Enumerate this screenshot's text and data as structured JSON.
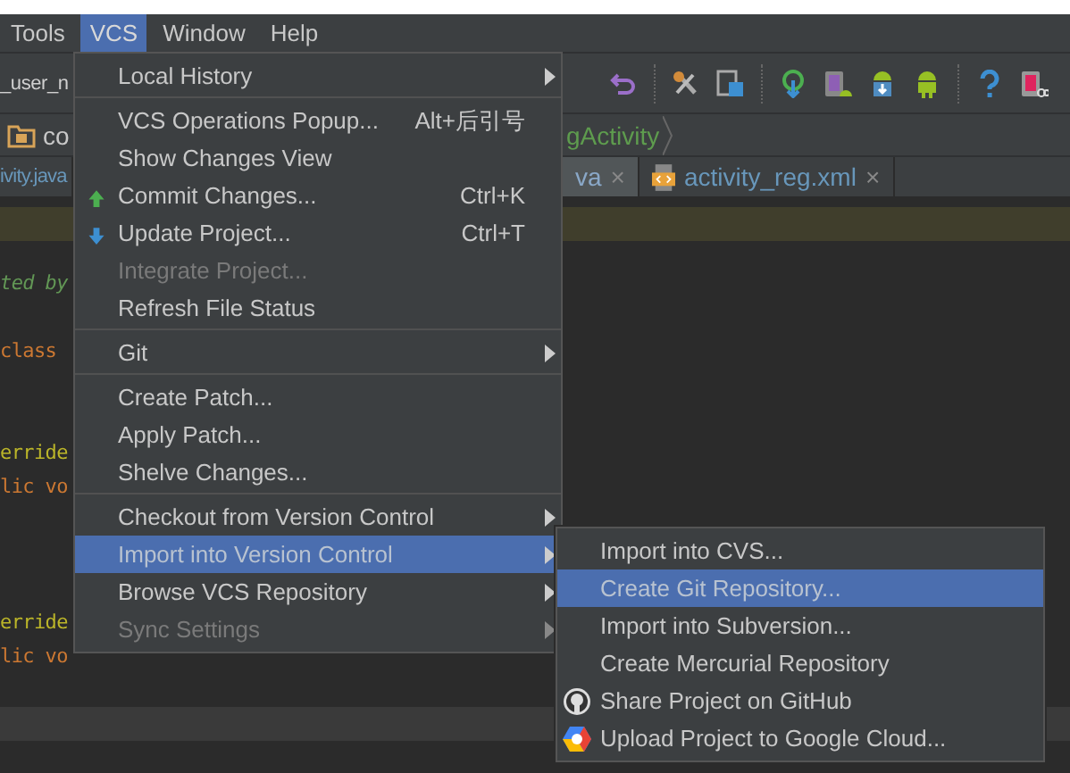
{
  "menubar": [
    {
      "label": "Tools",
      "selected": false
    },
    {
      "label": "VCS",
      "selected": true
    },
    {
      "label": "Window",
      "selected": false
    },
    {
      "label": "Help",
      "selected": false
    }
  ],
  "toolbar": {
    "field_value": "_user_n"
  },
  "breadcrumb": {
    "left": "co",
    "right": "gActivity"
  },
  "tabs": [
    {
      "label": "ivity.java",
      "selected": false,
      "kind": "java"
    },
    {
      "label": "va",
      "selected": true,
      "kind": "java",
      "close": "×"
    },
    {
      "label": "activity_reg.xml",
      "selected": false,
      "kind": "xml",
      "close": "×"
    }
  ],
  "code_lines": [
    {
      "text": "ted by",
      "kind": "comment",
      "current": false
    },
    {
      "kind": "blank",
      "current": false
    },
    {
      "text": "class",
      "kind": "keyword",
      "current": false
    },
    {
      "kind": "blank",
      "current": false
    },
    {
      "kind": "blank",
      "current": false
    },
    {
      "text": "erride",
      "kind": "annotation",
      "current": false
    },
    {
      "text": "lic vo",
      "kind": "keyword",
      "current": false
    },
    {
      "kind": "blank",
      "current": false
    },
    {
      "kind": "blank",
      "current": false
    },
    {
      "kind": "blank",
      "current": false
    },
    {
      "text": "erride",
      "kind": "annotation",
      "current": false
    },
    {
      "text": "lic vo",
      "kind": "keyword",
      "current": false
    },
    {
      "kind": "blank",
      "current": false
    },
    {
      "kind": "blank",
      "current": true
    },
    {
      "kind": "blank",
      "current": false
    }
  ],
  "vcs_menu": [
    {
      "kind": "item",
      "label": "Local History",
      "submenu": true,
      "disabled": false,
      "selected": false
    },
    {
      "kind": "separator"
    },
    {
      "kind": "item",
      "label": "VCS Operations Popup...",
      "shortcut": "Alt+后引号",
      "submenu": false,
      "disabled": false,
      "selected": false
    },
    {
      "kind": "item",
      "label": "Show Changes View",
      "submenu": false,
      "disabled": false,
      "selected": false
    },
    {
      "kind": "commit",
      "label": "Commit Changes...",
      "shortcut": "Ctrl+K",
      "submenu": false,
      "disabled": false,
      "selected": false
    },
    {
      "kind": "update",
      "label": "Update Project...",
      "shortcut": "Ctrl+T",
      "submenu": false,
      "disabled": false,
      "selected": false
    },
    {
      "kind": "item",
      "label": "Integrate Project...",
      "submenu": false,
      "disabled": true,
      "selected": false
    },
    {
      "kind": "item",
      "label": "Refresh File Status",
      "submenu": false,
      "disabled": false,
      "selected": false
    },
    {
      "kind": "separator"
    },
    {
      "kind": "item",
      "label": "Git",
      "submenu": true,
      "disabled": false,
      "selected": false
    },
    {
      "kind": "separator"
    },
    {
      "kind": "item",
      "label": "Create Patch...",
      "submenu": false,
      "disabled": false,
      "selected": false
    },
    {
      "kind": "item",
      "label": "Apply Patch...",
      "submenu": false,
      "disabled": false,
      "selected": false
    },
    {
      "kind": "item",
      "label": "Shelve Changes...",
      "submenu": false,
      "disabled": false,
      "selected": false
    },
    {
      "kind": "separator"
    },
    {
      "kind": "item",
      "label": "Checkout from Version Control",
      "submenu": true,
      "disabled": false,
      "selected": false
    },
    {
      "kind": "item",
      "label": "Import into Version Control",
      "submenu": true,
      "disabled": false,
      "selected": true
    },
    {
      "kind": "item",
      "label": "Browse VCS Repository",
      "submenu": true,
      "disabled": false,
      "selected": false
    },
    {
      "kind": "item",
      "label": "Sync Settings",
      "submenu": true,
      "disabled": true,
      "selected": false
    }
  ],
  "import_submenu": [
    {
      "kind": "item",
      "label": "Import into CVS...",
      "selected": false
    },
    {
      "kind": "item",
      "label": "Create Git Repository...",
      "selected": true
    },
    {
      "kind": "item",
      "label": "Import into Subversion...",
      "selected": false
    },
    {
      "kind": "item",
      "label": "Create Mercurial Repository",
      "selected": false
    },
    {
      "kind": "github",
      "label": "Share Project on GitHub",
      "selected": false
    },
    {
      "kind": "cloud",
      "label": "Upload Project to Google Cloud...",
      "selected": false
    }
  ]
}
